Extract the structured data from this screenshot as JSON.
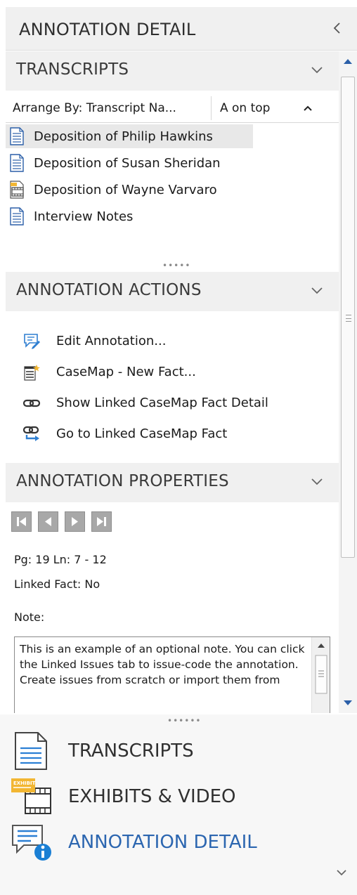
{
  "header": {
    "title": "ANNOTATION DETAIL"
  },
  "transcripts": {
    "title": "TRANSCRIPTS",
    "arrange_label": "Arrange By: Transcript Na...",
    "order_label": "A on top",
    "items": [
      {
        "label": "Deposition of Philip Hawkins",
        "icon": "transcript-doc-icon",
        "selected": true
      },
      {
        "label": "Deposition of Susan Sheridan",
        "icon": "transcript-doc-icon",
        "selected": false
      },
      {
        "label": "Deposition of Wayne Varvaro",
        "icon": "video-transcript-icon",
        "selected": false
      },
      {
        "label": "Interview Notes",
        "icon": "transcript-doc-icon",
        "selected": false
      }
    ]
  },
  "actions": {
    "title": "ANNOTATION ACTIONS",
    "items": [
      {
        "label": "Edit Annotation...",
        "icon": "edit-annotation-icon"
      },
      {
        "label": "CaseMap - New Fact...",
        "icon": "new-fact-icon"
      },
      {
        "label": "Show Linked CaseMap Fact Detail",
        "icon": "link-icon"
      },
      {
        "label": "Go to Linked CaseMap Fact",
        "icon": "link-arrow-icon"
      }
    ]
  },
  "properties": {
    "title": "ANNOTATION PROPERTIES",
    "page_line": "Pg: 19 Ln: 7 - 12",
    "linked_fact": "Linked Fact: No",
    "note_label": "Note:",
    "note_text": "This is an example of an optional note. You can click the Linked Issues tab to issue-code the annotation. Create issues from scratch or import them from"
  },
  "bottom_nav": {
    "items": [
      {
        "label": "TRANSCRIPTS",
        "icon": "transcript-page-icon",
        "active": false
      },
      {
        "label": "EXHIBITS & VIDEO",
        "icon": "exhibit-film-icon",
        "active": false
      },
      {
        "label": "ANNOTATION DETAIL",
        "icon": "annotation-info-icon",
        "active": true
      }
    ]
  },
  "colors": {
    "accent": "#2c66b0",
    "section_bg": "#f0f0f0",
    "selected_bg": "#e8e8e8",
    "info_blue": "#1a7fd4"
  }
}
